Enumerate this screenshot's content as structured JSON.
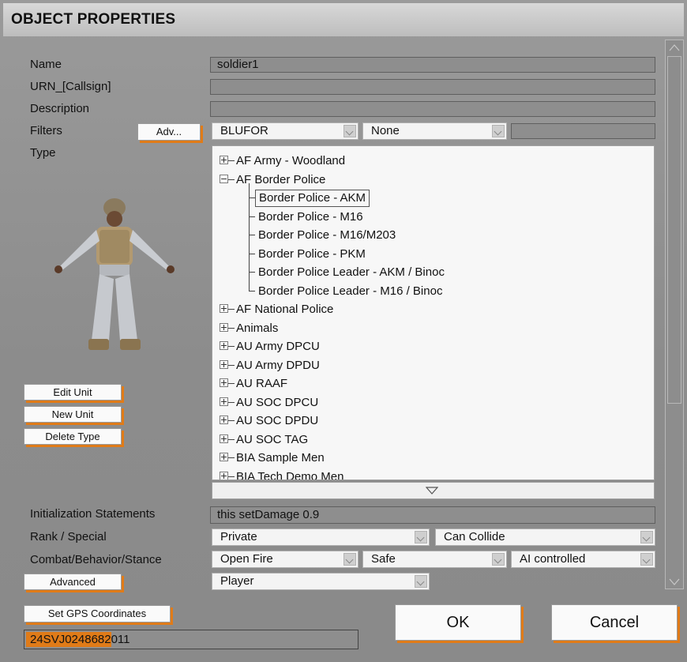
{
  "title": "OBJECT PROPERTIES",
  "labels": {
    "name": "Name",
    "urn": "URN_[Callsign]",
    "description": "Description",
    "filters": "Filters",
    "type": "Type",
    "init": "Initialization Statements",
    "rank": "Rank / Special",
    "combat": "Combat/Behavior/Stance"
  },
  "fields": {
    "name": "soldier1",
    "urn": "",
    "description": "",
    "filter_text": "",
    "init": "this setDamage 0.9",
    "gps": "24SVJ0248682011"
  },
  "filters": {
    "adv_button": "Adv...",
    "side": "BLUFOR",
    "faction": "None"
  },
  "unit_buttons": {
    "edit": "Edit Unit",
    "new": "New Unit",
    "delete": "Delete Type"
  },
  "tree": {
    "items": [
      {
        "label": "AF Army - Woodland",
        "level": 0,
        "expander": "plus"
      },
      {
        "label": "AF Border Police",
        "level": 0,
        "expander": "minus"
      },
      {
        "label": "Border Police - AKM",
        "level": 1,
        "selected": true
      },
      {
        "label": "Border Police - M16",
        "level": 1
      },
      {
        "label": "Border Police - M16/M203",
        "level": 1
      },
      {
        "label": "Border Police - PKM",
        "level": 1
      },
      {
        "label": "Border Police Leader - AKM / Binoc",
        "level": 1
      },
      {
        "label": "Border Police Leader - M16 / Binoc",
        "level": 1,
        "last": true
      },
      {
        "label": "AF National Police",
        "level": 0,
        "expander": "plus"
      },
      {
        "label": "Animals",
        "level": 0,
        "expander": "plus"
      },
      {
        "label": "AU Army DPCU",
        "level": 0,
        "expander": "plus"
      },
      {
        "label": "AU Army DPDU",
        "level": 0,
        "expander": "plus"
      },
      {
        "label": "AU RAAF",
        "level": 0,
        "expander": "plus"
      },
      {
        "label": "AU SOC DPCU",
        "level": 0,
        "expander": "plus"
      },
      {
        "label": "AU SOC DPDU",
        "level": 0,
        "expander": "plus"
      },
      {
        "label": "AU SOC TAG",
        "level": 0,
        "expander": "plus"
      },
      {
        "label": "BIA Sample Men",
        "level": 0,
        "expander": "plus"
      },
      {
        "label": "BIA Tech Demo Men",
        "level": 0,
        "expander": "plus"
      }
    ]
  },
  "rank": {
    "value": "Private",
    "special": "Can Collide"
  },
  "combat": {
    "mode": "Open Fire",
    "behavior": "Safe",
    "stance": "AI controlled"
  },
  "advanced": {
    "button": "Advanced",
    "control": "Player"
  },
  "gps": {
    "button": "Set GPS Coordinates"
  },
  "actions": {
    "ok": "OK",
    "cancel": "Cancel"
  },
  "colors": {
    "accent": "#e07b18",
    "panel": "#8e8e8e"
  }
}
